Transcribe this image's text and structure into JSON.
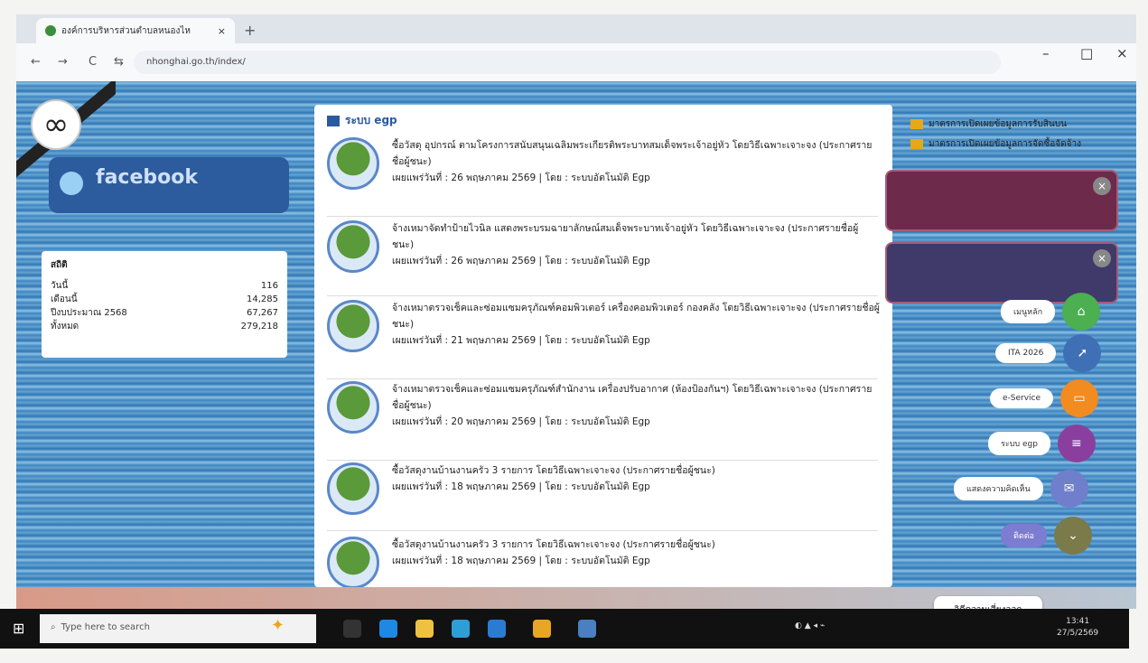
{
  "browser": {
    "tab_title": "องค์การบริหารส่วนตำบลหนองไห",
    "tab_close": "×",
    "new_tab": "+",
    "url": "nhonghai.go.th/index/",
    "nav_back": "←",
    "nav_forward": "→",
    "nav_reload": "C",
    "site_info": "⇆",
    "win_min": "–",
    "win_max": "□",
    "win_close": "×",
    "star_icon": "☆",
    "reader_icon": "☰",
    "profile_icon": "◉",
    "menu_icon": "⋮"
  },
  "left": {
    "facebook_label": "facebook",
    "stats_heading": "สถิติ",
    "stats": [
      {
        "label": "วันนี้",
        "value": "116"
      },
      {
        "label": "เดือนนี้",
        "value": "14,285"
      },
      {
        "label": "ปีงบประมาณ 2568",
        "value": "67,267"
      },
      {
        "label": "ทั้งหมด",
        "value": "279,218"
      }
    ]
  },
  "news": {
    "title": "ระบบ egp",
    "items": [
      {
        "title": "ซื้อวัสดุ อุปกรณ์ ตามโครงการสนับสนุนเฉลิมพระเกียรติพระบาทสมเด็จพระเจ้าอยู่หัว โดยวิธีเฉพาะเจาะจง (ประกาศรายชื่อผู้ชนะ)",
        "meta": "เผยแพร่วันที่ : 26 พฤษภาคม 2569 | โดย : ระบบอัตโนมัติ Egp"
      },
      {
        "title": "จ้างเหมาจัดทำป้ายไวนิล แสดงพระบรมฉายาลักษณ์สมเด็จพระบาทเจ้าอยู่หัว โดยวิธีเฉพาะเจาะจง (ประกาศรายชื่อผู้ชนะ)",
        "meta": "เผยแพร่วันที่ : 26 พฤษภาคม 2569 | โดย : ระบบอัตโนมัติ Egp"
      },
      {
        "title": "จ้างเหมาตรวจเช็คและซ่อมแซมครุภัณฑ์คอมพิวเตอร์ เครื่องคอมพิวเตอร์ กองคลัง โดยวิธีเฉพาะเจาะจง (ประกาศรายชื่อผู้ชนะ)",
        "meta": "เผยแพร่วันที่ : 21 พฤษภาคม 2569 | โดย : ระบบอัตโนมัติ Egp"
      },
      {
        "title": "จ้างเหมาตรวจเช็คและซ่อมแซมครุภัณฑ์สำนักงาน เครื่องปรับอากาศ (ห้องป้องกันฯ) โดยวิธีเฉพาะเจาะจง (ประกาศรายชื่อผู้ชนะ)",
        "meta": "เผยแพร่วันที่ : 20 พฤษภาคม 2569 | โดย : ระบบอัตโนมัติ Egp"
      },
      {
        "title": "ซื้อวัสดุงานบ้านงานครัว 3 รายการ โดยวิธีเฉพาะเจาะจง (ประกาศรายชื่อผู้ชนะ)",
        "meta": "เผยแพร่วันที่ : 18 พฤษภาคม 2569 | โดย : ระบบอัตโนมัติ Egp"
      },
      {
        "title": "ซื้อวัสดุงานบ้านงานครัว 3 รายการ โดยวิธีเฉพาะเจาะจง (ประกาศรายชื่อผู้ชนะ)",
        "meta": "เผยแพร่วันที่ : 18 พฤษภาคม 2569 | โดย : ระบบอัตโนมัติ Egp"
      }
    ]
  },
  "right": {
    "links": [
      "มาตรการเปิดเผยข้อมูลการรับสินบน",
      "มาตรการเปิดเผยข้อมูลการจัดซื้อจัดจ้าง"
    ],
    "banner_close": "×",
    "fab": [
      {
        "label": "เมนูหลัก",
        "color": "#4caf50",
        "icon": "⌂"
      },
      {
        "label": "ITA 2026",
        "color": "#3f6fb5",
        "icon": "➚"
      },
      {
        "label": "e-Service",
        "color": "#f28b20",
        "icon": "▭"
      },
      {
        "label": "ระบบ egp",
        "color": "#8a3f9e",
        "icon": "≡"
      },
      {
        "label": "แสดงความคิดเห็น",
        "color": "#6f7fcc",
        "icon": "✉"
      },
      {
        "label": "ติดต่อ",
        "color": "#7a7a4a",
        "icon": "⌄"
      }
    ]
  },
  "popup_label": "วิดีความเสี่ยงออก",
  "taskbar": {
    "search_placeholder": "Type here to search",
    "clock_time": "13:41",
    "clock_date": "27/5/2569"
  }
}
